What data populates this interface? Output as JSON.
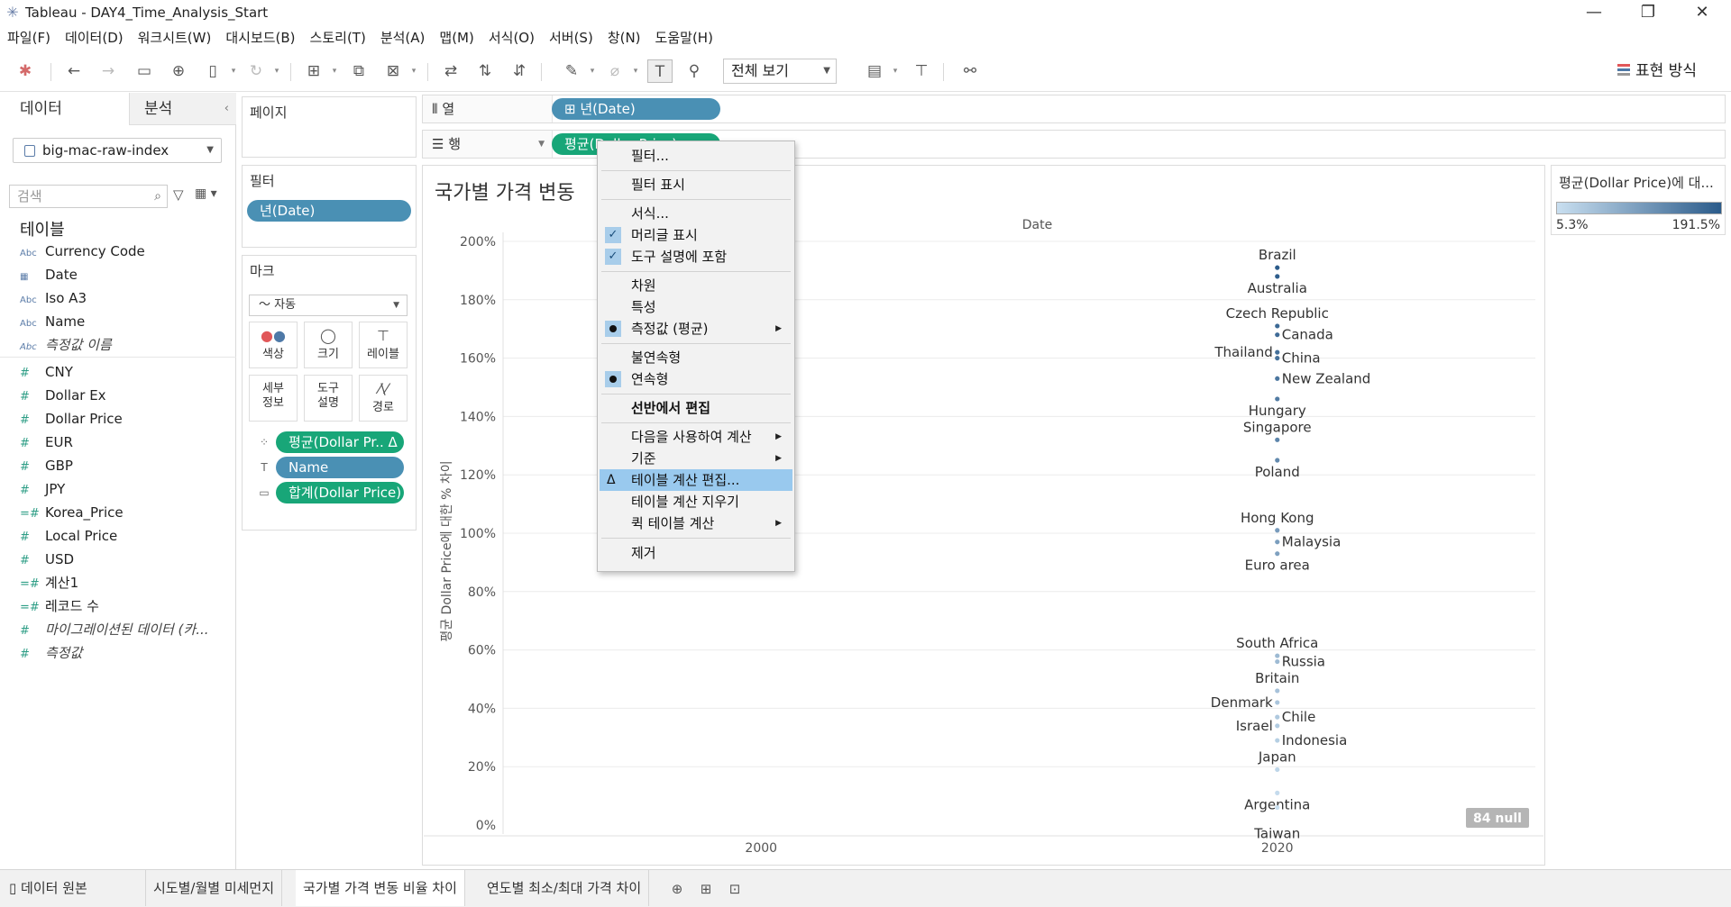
{
  "window": {
    "title": "Tableau - DAY4_Time_Analysis_Start",
    "minimize": "—",
    "restore": "❐",
    "close": "✕"
  },
  "menubar": [
    "파일(F)",
    "데이터(D)",
    "워크시트(W)",
    "대시보드(B)",
    "스토리(T)",
    "분석(A)",
    "맵(M)",
    "서식(O)",
    "서버(S)",
    "창(N)",
    "도움말(H)"
  ],
  "toolbar": {
    "fit_value": "전체 보기",
    "show_me_label": "표현 방식"
  },
  "data_pane": {
    "tab_data": "데이터",
    "tab_analysis": "분석",
    "collapse_glyph": "‹",
    "datasource": "big-mac-raw-index",
    "search_placeholder": "검색",
    "tables_heading": "테이블",
    "dimensions": [
      {
        "type": "Abc",
        "name": "Currency Code"
      },
      {
        "type": "▦",
        "name": "Date"
      },
      {
        "type": "Abc",
        "name": "Iso A3"
      },
      {
        "type": "Abc",
        "name": "Name"
      },
      {
        "type": "Abc",
        "name": "측정값 이름"
      }
    ],
    "measures": [
      {
        "type": "#",
        "name": "CNY"
      },
      {
        "type": "#",
        "name": "Dollar Ex"
      },
      {
        "type": "#",
        "name": "Dollar Price"
      },
      {
        "type": "#",
        "name": "EUR"
      },
      {
        "type": "#",
        "name": "GBP"
      },
      {
        "type": "#",
        "name": "JPY"
      },
      {
        "type": "=#",
        "name": "Korea_Price"
      },
      {
        "type": "#",
        "name": "Local Price"
      },
      {
        "type": "#",
        "name": "USD"
      },
      {
        "type": "=#",
        "name": "계산1"
      },
      {
        "type": "=#",
        "name": "레코드 수"
      },
      {
        "type": "#",
        "name": "마이그레이션된 데이터 (카..."
      },
      {
        "type": "#",
        "name": "측정값"
      }
    ]
  },
  "pages_card": {
    "title": "페이지"
  },
  "filters_card": {
    "title": "필터",
    "pill": "년(Date)"
  },
  "marks_card": {
    "title": "마크",
    "mark_type": "자동",
    "mark_type_icon": "〜",
    "buttons": {
      "color": "색상",
      "size": "크기",
      "label": "레이블",
      "detail_1": "세부",
      "detail_2": "정보",
      "tooltip_1": "도구",
      "tooltip_2": "설명",
      "path": "경로"
    },
    "pills": [
      {
        "icon": "⁘",
        "label": "평균(Dollar Pr.. Δ"
      },
      {
        "icon": "T",
        "label": "Name"
      },
      {
        "icon": "▭",
        "label": "합계(Dollar Price)"
      }
    ]
  },
  "shelves": {
    "columns_label": "열",
    "columns_pill": "⊞ 년(Date)",
    "rows_label": "행",
    "rows_pill": "평균(Dollar Price)"
  },
  "view": {
    "title": "국가별 가격 변동",
    "null_badge": "84 null"
  },
  "legend": {
    "title": "평균(Dollar Price)에 대...",
    "min": "5.3%",
    "max": "191.5%"
  },
  "context_menu": {
    "items": [
      {
        "label": "필터..."
      },
      {
        "label": "필터 표시"
      },
      {
        "label": "서식..."
      },
      {
        "label": "머리글 표시",
        "check": "✓"
      },
      {
        "label": "도구 설명에 포함",
        "check": "✓"
      },
      {
        "label": "차원"
      },
      {
        "label": "특성"
      },
      {
        "label": "측정값 (평균)"
      },
      {
        "label": "불연속형"
      },
      {
        "label": "연속형"
      },
      {
        "label": "선반에서 편집"
      },
      {
        "label": "다음을 사용하여 계산"
      },
      {
        "label": "기준"
      },
      {
        "label": "테이블 계산 편집...",
        "marker": "Δ"
      },
      {
        "label": "테이블 계산 지우기"
      },
      {
        "label": "퀵 테이블 계산"
      },
      {
        "label": "제거"
      }
    ]
  },
  "bottom_tabs": {
    "datasource": "데이터 원본",
    "sheets": [
      "시도별/월별 미세먼지",
      "국가별 가격 변동 비율 차이",
      "연도별 최소/최대 가격 차이"
    ]
  },
  "chart_data": {
    "type": "scatter",
    "x_axis_title": "Date",
    "y_axis_title": "평균 Dollar Price에 대한 % 차이",
    "categories": [
      "2000",
      "2020"
    ],
    "y_ticks": [
      "0%",
      "20%",
      "40%",
      "60%",
      "80%",
      "100%",
      "120%",
      "140%",
      "160%",
      "180%",
      "200%"
    ],
    "ylim": [
      0,
      200
    ],
    "points": [
      {
        "x": "2020",
        "y": 191,
        "label": "Brazil",
        "side": "above"
      },
      {
        "x": "2020",
        "y": 188,
        "label": "Australia",
        "side": "below"
      },
      {
        "x": "2020",
        "y": 171,
        "label": "Czech Republic",
        "side": "above"
      },
      {
        "x": "2020",
        "y": 168,
        "label": "Canada",
        "side": "right"
      },
      {
        "x": "2020",
        "y": 162,
        "label": "Thailand",
        "side": "left"
      },
      {
        "x": "2020",
        "y": 160,
        "label": "China",
        "side": "right"
      },
      {
        "x": "2020",
        "y": 153,
        "label": "New Zealand",
        "side": "right"
      },
      {
        "x": "2020",
        "y": 146,
        "label": "Hungary",
        "side": "below"
      },
      {
        "x": "2020",
        "y": 132,
        "label": "Singapore",
        "side": "above"
      },
      {
        "x": "2020",
        "y": 125,
        "label": "Poland",
        "side": "below"
      },
      {
        "x": "2020",
        "y": 101,
        "label": "Hong Kong",
        "side": "above"
      },
      {
        "x": "2020",
        "y": 97,
        "label": "Malaysia",
        "side": "right"
      },
      {
        "x": "2020",
        "y": 93,
        "label": "Euro area",
        "side": "below"
      },
      {
        "x": "2020",
        "y": 58,
        "label": "South Africa",
        "side": "above"
      },
      {
        "x": "2020",
        "y": 56,
        "label": "Russia",
        "side": "right"
      },
      {
        "x": "2020",
        "y": 46,
        "label": "Britain",
        "side": "above"
      },
      {
        "x": "2020",
        "y": 42,
        "label": "Denmark",
        "side": "left"
      },
      {
        "x": "2020",
        "y": 37,
        "label": "Chile",
        "side": "right"
      },
      {
        "x": "2020",
        "y": 34,
        "label": "Israel",
        "side": "left"
      },
      {
        "x": "2020",
        "y": 29,
        "label": "Indonesia",
        "side": "right"
      },
      {
        "x": "2020",
        "y": 19,
        "label": "Japan",
        "side": "above"
      },
      {
        "x": "2020",
        "y": 11,
        "label": "Argentina",
        "side": "below"
      },
      {
        "x": "2020",
        "y": 6,
        "label": "Taiwan",
        "side": "below2"
      }
    ],
    "color_range": [
      "#c9dff0",
      "#2b5b8a"
    ]
  }
}
